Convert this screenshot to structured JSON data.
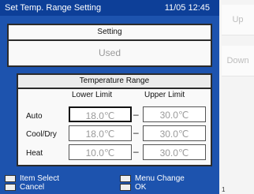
{
  "titlebar": {
    "title": "Set Temp. Range Setting",
    "time": "11/05 12:45"
  },
  "setting": {
    "header": "Setting",
    "value": "Used"
  },
  "range": {
    "header": "Temperature Range",
    "col_lower": "Lower Limit",
    "col_upper": "Upper Limit",
    "dash": "–",
    "rows": [
      {
        "label": "Auto",
        "lower": "18.0℃",
        "upper": "30.0℃"
      },
      {
        "label": "Cool/Dry",
        "lower": "18.0℃",
        "upper": "30.0℃"
      },
      {
        "label": "Heat",
        "lower": "10.0℃",
        "upper": "30.0℃"
      }
    ]
  },
  "footer": {
    "item_select": "Item Select",
    "menu_change": "Menu Change",
    "cancel": "Cancel",
    "ok": "OK"
  },
  "side": {
    "up": "Up",
    "down": "Down",
    "page": "1"
  }
}
